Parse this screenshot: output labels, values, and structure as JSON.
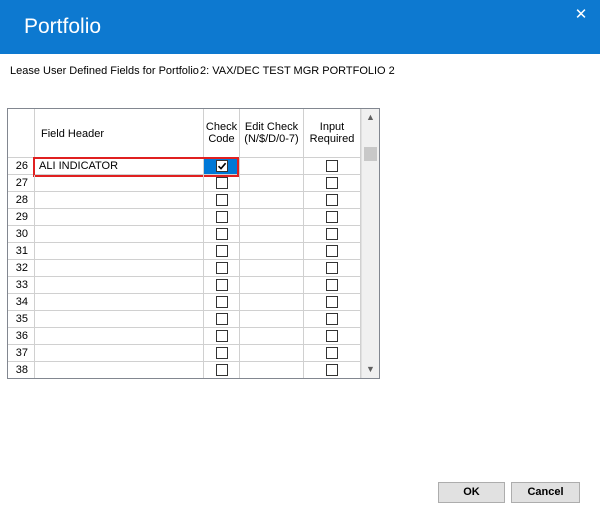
{
  "window": {
    "title": "Portfolio",
    "close_glyph": "✕"
  },
  "subheader": {
    "label": "Lease User Defined Fields for Portfolio",
    "portfolio": "2: VAX/DEC TEST MGR PORTFOLIO 2"
  },
  "grid": {
    "headers": {
      "field_header": "Field Header",
      "check_code_1": "Check",
      "check_code_2": "Code",
      "edit_check_1": "Edit Check",
      "edit_check_2": "(N/$/D/0-7)",
      "input_req_1": "Input",
      "input_req_2": "Required"
    },
    "rows": [
      {
        "num": "26",
        "field": "ALI INDICATOR",
        "check_code": true,
        "edit_check": "",
        "input_required": false
      },
      {
        "num": "27",
        "field": "",
        "check_code": false,
        "edit_check": "",
        "input_required": false
      },
      {
        "num": "28",
        "field": "",
        "check_code": false,
        "edit_check": "",
        "input_required": false
      },
      {
        "num": "29",
        "field": "",
        "check_code": false,
        "edit_check": "",
        "input_required": false
      },
      {
        "num": "30",
        "field": "",
        "check_code": false,
        "edit_check": "",
        "input_required": false
      },
      {
        "num": "31",
        "field": "",
        "check_code": false,
        "edit_check": "",
        "input_required": false
      },
      {
        "num": "32",
        "field": "",
        "check_code": false,
        "edit_check": "",
        "input_required": false
      },
      {
        "num": "33",
        "field": "",
        "check_code": false,
        "edit_check": "",
        "input_required": false
      },
      {
        "num": "34",
        "field": "",
        "check_code": false,
        "edit_check": "",
        "input_required": false
      },
      {
        "num": "35",
        "field": "",
        "check_code": false,
        "edit_check": "",
        "input_required": false
      },
      {
        "num": "36",
        "field": "",
        "check_code": false,
        "edit_check": "",
        "input_required": false
      },
      {
        "num": "37",
        "field": "",
        "check_code": false,
        "edit_check": "",
        "input_required": false
      },
      {
        "num": "38",
        "field": "",
        "check_code": false,
        "edit_check": "",
        "input_required": false
      }
    ],
    "selected_row": 0,
    "scroll_up_glyph": "▲",
    "scroll_down_glyph": "▼"
  },
  "buttons": {
    "ok": "OK",
    "cancel": "Cancel"
  },
  "colors": {
    "title_bar": "#0d79d0",
    "selection": "#0078d7",
    "highlight_border": "#e02020"
  }
}
